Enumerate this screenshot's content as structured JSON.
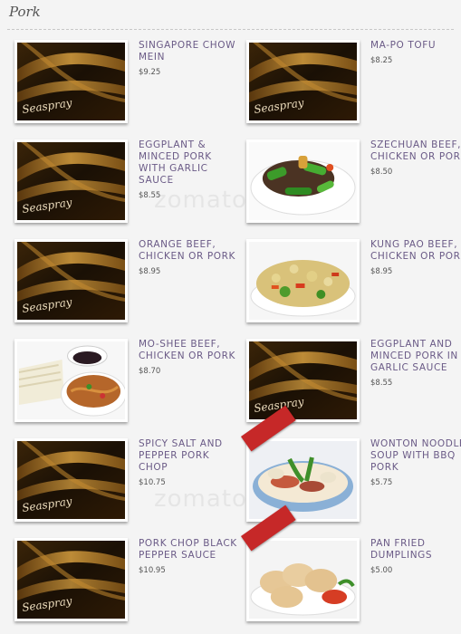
{
  "section": {
    "title": "Pork"
  },
  "watermark": "zomato",
  "logo_text": "Seaspray",
  "colors": {
    "title": "#6a5a86",
    "price": "#555555",
    "ribbon": "#c62828"
  },
  "items": [
    {
      "name": "Singapore Chow Mein",
      "price": "$9.25",
      "image": "logo"
    },
    {
      "name": "Ma-Po Tofu",
      "price": "$8.25",
      "image": "logo"
    },
    {
      "name": "Eggplant & Minced Pork with Garlic Sauce",
      "price": "$8.55",
      "image": "logo"
    },
    {
      "name": "Szechuan Beef, Chicken or Pork",
      "price": "$8.50",
      "image": "food-stirfry"
    },
    {
      "name": "Orange Beef, Chicken or Pork",
      "price": "$8.95",
      "image": "logo"
    },
    {
      "name": "Kung Pao Beef, Chicken or Pork",
      "price": "$8.95",
      "image": "food-kungpao"
    },
    {
      "name": "Mo-Shee Beef, Chicken or Pork",
      "price": "$8.70",
      "image": "food-moshee"
    },
    {
      "name": "Eggplant and Minced Pork in Garlic Sauce",
      "price": "$8.55",
      "image": "logo"
    },
    {
      "name": "Spicy Salt and Pepper Pork Chop",
      "price": "$10.75",
      "image": "logo"
    },
    {
      "name": "Wonton Noodle Soup with BBQ Pork",
      "price": "$5.75",
      "image": "food-soup"
    },
    {
      "name": "Pork Chop Black Pepper Sauce",
      "price": "$10.95",
      "image": "logo"
    },
    {
      "name": "Pan Fried Dumplings",
      "price": "$5.00",
      "image": "food-dumplings"
    }
  ]
}
